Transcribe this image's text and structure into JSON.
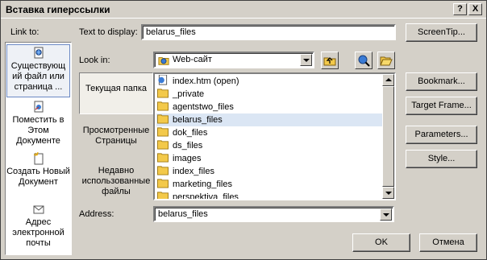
{
  "window": {
    "title": "Вставка гиперссылки",
    "help_glyph": "?",
    "close_glyph": "X"
  },
  "link_to_label": "Link to:",
  "sidebar": {
    "items": [
      {
        "label": "Существующ ий файл или страница ...",
        "icon": "existing-file-icon",
        "selected": true
      },
      {
        "label": "Поместить в Этом Документе",
        "icon": "place-in-document-icon",
        "selected": false
      },
      {
        "label": "Создать Новый Документ",
        "icon": "new-document-icon",
        "selected": false
      },
      {
        "label": "Адрес электронной почты",
        "icon": "email-address-icon",
        "selected": false
      }
    ]
  },
  "text_to_display": {
    "label": "Text to display:",
    "value": "belarus_files"
  },
  "screentip_label": "ScreenTip...",
  "look_in": {
    "label": "Look in:",
    "value": "Web-сайт",
    "icon": "web-folder-icon"
  },
  "places": [
    {
      "label": "Текущая папка",
      "selected": true
    },
    {
      "label": "Просмотренные Страницы",
      "selected": false
    },
    {
      "label": "Недавно использованные файлы",
      "selected": false
    }
  ],
  "files": [
    {
      "name": "index.htm (open)",
      "type": "html-file-icon",
      "selected": false
    },
    {
      "name": "_private",
      "type": "folder-icon",
      "selected": false
    },
    {
      "name": "agentstwo_files",
      "type": "folder-icon",
      "selected": false
    },
    {
      "name": "belarus_files",
      "type": "folder-icon",
      "selected": true
    },
    {
      "name": "dok_files",
      "type": "folder-icon",
      "selected": false
    },
    {
      "name": "ds_files",
      "type": "folder-icon",
      "selected": false
    },
    {
      "name": "images",
      "type": "folder-icon",
      "selected": false
    },
    {
      "name": "index_files",
      "type": "folder-icon",
      "selected": false
    },
    {
      "name": "marketing_files",
      "type": "folder-icon",
      "selected": false
    },
    {
      "name": "perspektiva_files",
      "type": "folder-icon",
      "selected": false
    }
  ],
  "address": {
    "label": "Address:",
    "value": "belarus_files"
  },
  "buttons": {
    "bookmark": "Bookmark...",
    "target_frame": "Target Frame...",
    "parameters": "Parameters...",
    "style": "Style...",
    "ok": "OK",
    "cancel": "Отмена"
  },
  "colors": {
    "dialog_face": "#d4d0c8",
    "selection": "#dbe6f4",
    "folder": "#f3c94a"
  }
}
